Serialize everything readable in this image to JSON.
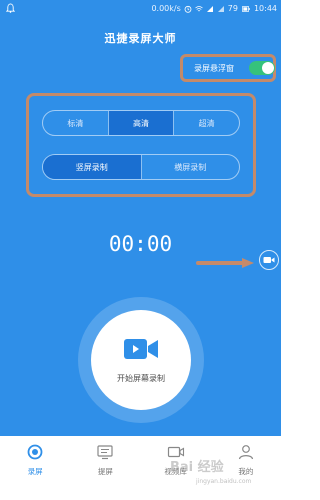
{
  "status_bar": {
    "speed": "0.00k/s",
    "battery": "79",
    "time": "10:44"
  },
  "header": {
    "title": "迅捷录屏大师"
  },
  "floating_window": {
    "label": "录屏悬浮窗",
    "enabled": true
  },
  "quality": {
    "options": [
      "标清",
      "高清",
      "超清"
    ],
    "selected": "高清"
  },
  "orientation": {
    "options": [
      "竖屏录制",
      "横屏录制"
    ],
    "selected": "竖屏录制"
  },
  "timer": {
    "value": "00:00"
  },
  "record": {
    "label": "开始屏幕录制"
  },
  "nav": {
    "items": [
      "录屏",
      "提屏",
      "视频库",
      "我的"
    ],
    "active": "录屏"
  },
  "watermark": {
    "text": "Bai 经验",
    "sub": "jingyan.baidu.com"
  },
  "colors": {
    "background": "#2f8fe8",
    "selected_segment": "#1a6fd1",
    "toggle_on": "#36c27b",
    "highlight_border": "#c48a6a"
  }
}
